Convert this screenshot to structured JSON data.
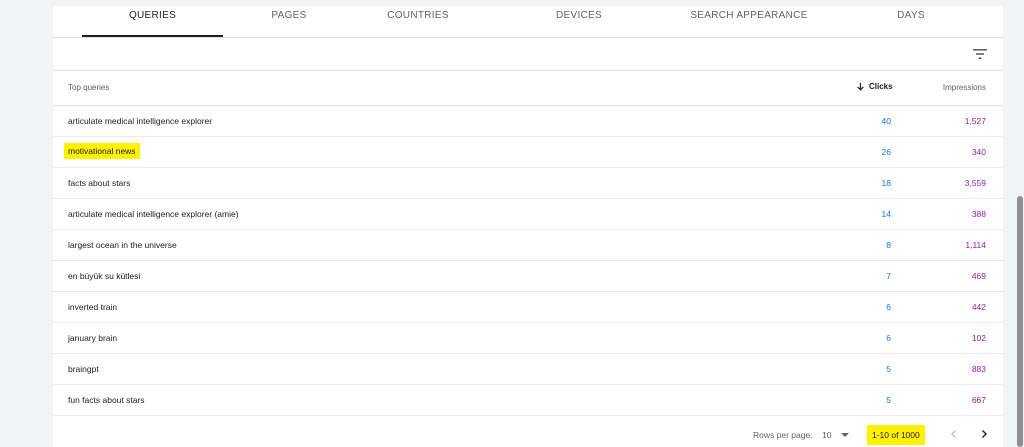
{
  "tabs": [
    {
      "label": "QUERIES",
      "active": true
    },
    {
      "label": "PAGES"
    },
    {
      "label": "COUNTRIES"
    },
    {
      "label": "DEVICES"
    },
    {
      "label": "SEARCH APPEARANCE"
    },
    {
      "label": "DAYS"
    }
  ],
  "filter_icon": "filter-list-icon",
  "table": {
    "headers": {
      "queries": "Top queries",
      "clicks": "Clicks",
      "impressions": "Impressions"
    },
    "sort_icon": "arrow-down-icon",
    "rows": [
      {
        "query": "articulate medical intelligence explorer",
        "clicks": "40",
        "impressions": "1,527"
      },
      {
        "query": "motivational news",
        "clicks": "26",
        "impressions": "340",
        "highlighted": true
      },
      {
        "query": "facts about stars",
        "clicks": "18",
        "impressions": "3,559"
      },
      {
        "query": "articulate medical intelligence explorer (amie)",
        "clicks": "14",
        "impressions": "388"
      },
      {
        "query": "largest ocean in the universe",
        "clicks": "8",
        "impressions": "1,114"
      },
      {
        "query": "en büyük su kütlesi",
        "clicks": "7",
        "impressions": "469"
      },
      {
        "query": "inverted train",
        "clicks": "6",
        "impressions": "442"
      },
      {
        "query": "january brain",
        "clicks": "6",
        "impressions": "102"
      },
      {
        "query": "braingpt",
        "clicks": "5",
        "impressions": "883"
      },
      {
        "query": "fun facts about stars",
        "clicks": "5",
        "impressions": "667"
      }
    ]
  },
  "pagination": {
    "rows_per_page_label": "Rows per page:",
    "rows_per_page_value": "10",
    "range": "1-10 of 1000",
    "prev_icon": "chevron-left-icon",
    "next_icon": "chevron-right-icon"
  },
  "colors": {
    "clicks": "#1a73e8",
    "impressions": "#8e24aa",
    "highlight": "#fff200"
  }
}
